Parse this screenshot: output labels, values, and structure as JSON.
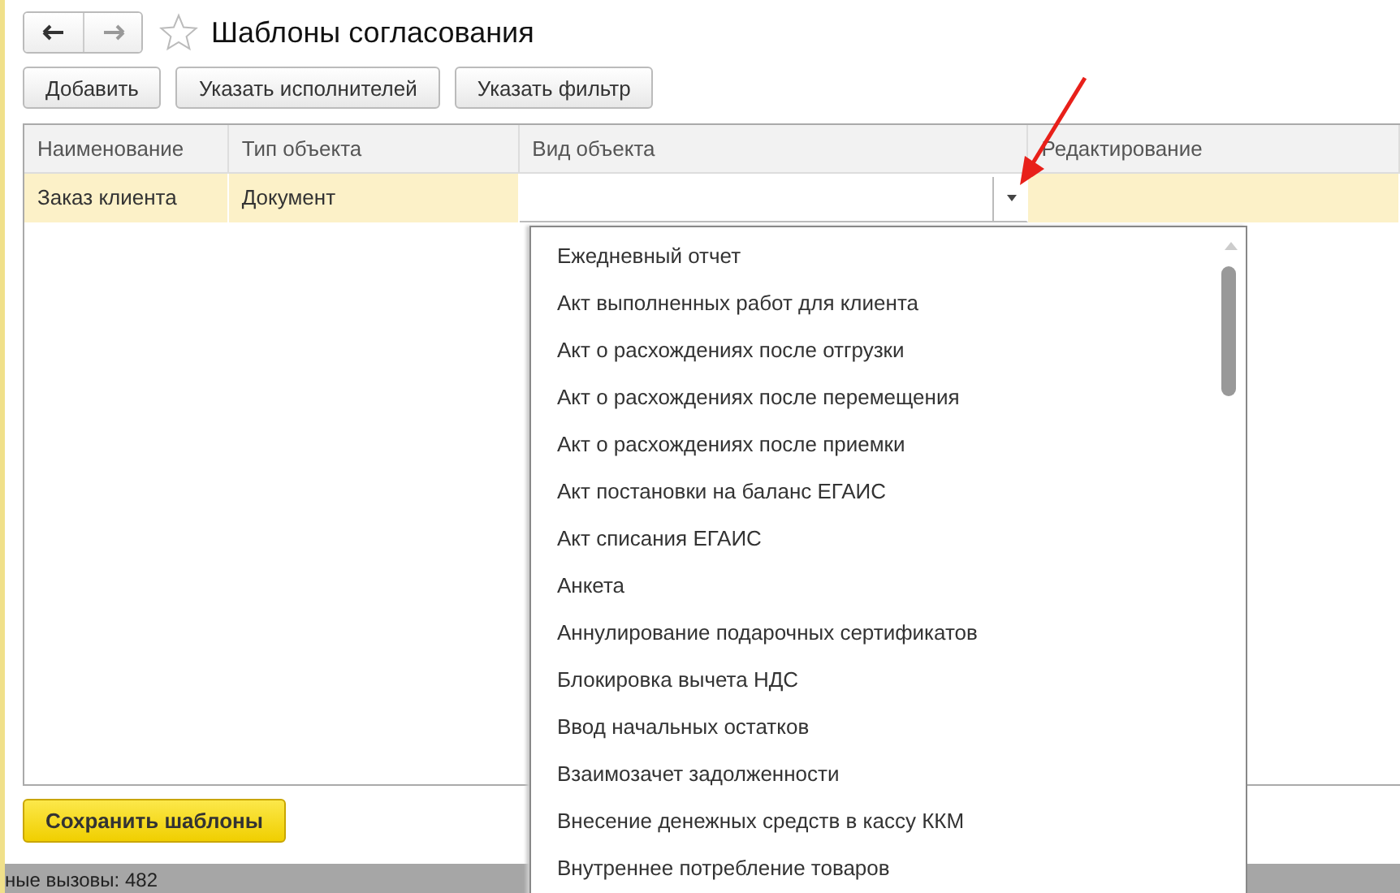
{
  "window": {
    "title": "Шаблоны согласования",
    "favorite": false
  },
  "toolbar": [
    "Добавить",
    "Указать исполнителей",
    "Указать фильтр"
  ],
  "table": {
    "columns": [
      "Наименование",
      "Тип объекта",
      "Вид объекта",
      "Редактирование"
    ],
    "rows": [
      {
        "cells": [
          "Заказ клиента",
          "Документ",
          "",
          ""
        ],
        "selected": true
      }
    ]
  },
  "dropdown": {
    "items": [
      "Ежедневный отчет",
      "Акт выполненных работ для клиента",
      "Акт о расхождениях после отгрузки",
      "Акт о расхождениях после перемещения",
      "Акт о расхождениях после приемки",
      "Акт постановки на баланс ЕГАИС",
      "Акт списания ЕГАИС",
      "Анкета",
      "Аннулирование подарочных сертификатов",
      "Блокировка вычета НДС",
      "Ввод начальных остатков",
      "Взаимозачет задолженности",
      "Внесение денежных средств в кассу ККМ",
      "Внутреннее потребление товаров"
    ]
  },
  "save_button": "Сохранить шаблоны",
  "status_bar": "ные вызовы: 482"
}
